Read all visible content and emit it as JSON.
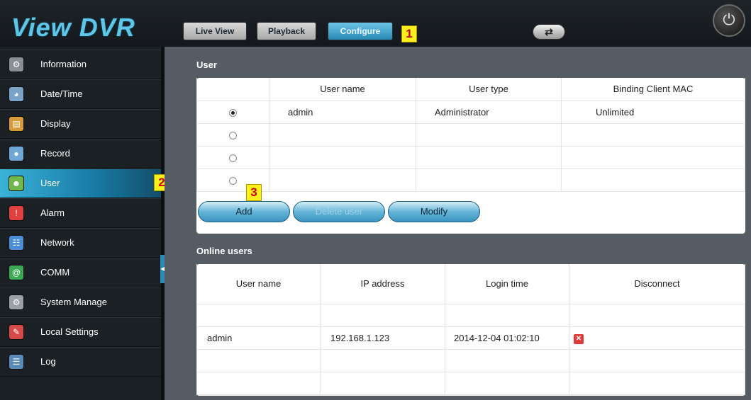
{
  "app": {
    "title": "View DVR"
  },
  "top_nav": {
    "live_view": "Live View",
    "playback": "Playback",
    "configure": "Configure"
  },
  "callouts": {
    "c1": "1",
    "c2": "2",
    "c3": "3"
  },
  "sidebar": {
    "items": [
      {
        "label": "Information",
        "icon": "information-icon",
        "color": "#8a8f96"
      },
      {
        "label": "Date/Time",
        "icon": "clock-icon",
        "color": "#7aa3c8"
      },
      {
        "label": "Display",
        "icon": "display-icon",
        "color": "#d99b3a"
      },
      {
        "label": "Record",
        "icon": "record-icon",
        "color": "#6fa7d6"
      },
      {
        "label": "User",
        "icon": "user-icon",
        "color": "#6fb84a"
      },
      {
        "label": "Alarm",
        "icon": "alarm-icon",
        "color": "#e04040"
      },
      {
        "label": "Network",
        "icon": "network-icon",
        "color": "#4a8ed8"
      },
      {
        "label": "COMM",
        "icon": "comm-icon",
        "color": "#3aa855"
      },
      {
        "label": "System Manage",
        "icon": "system-manage-icon",
        "color": "#9aa0a6"
      },
      {
        "label": "Local Settings",
        "icon": "local-settings-icon",
        "color": "#d84a4a"
      },
      {
        "label": "Log",
        "icon": "log-icon",
        "color": "#5a8ab8"
      }
    ],
    "active_index": 4
  },
  "user_section": {
    "title": "User",
    "columns": [
      "User name",
      "User type",
      "Binding Client MAC"
    ],
    "rows": [
      {
        "selected": true,
        "name": "admin",
        "type": "Administrator",
        "mac": "Unlimited"
      },
      {
        "selected": false,
        "name": "",
        "type": "",
        "mac": ""
      },
      {
        "selected": false,
        "name": "",
        "type": "",
        "mac": ""
      },
      {
        "selected": false,
        "name": "",
        "type": "",
        "mac": ""
      }
    ],
    "buttons": {
      "add": "Add",
      "delete": "Delete user",
      "modify": "Modify"
    }
  },
  "online_section": {
    "title": "Online users",
    "columns": [
      "User name",
      "IP address",
      "Login time",
      "Disconnect"
    ],
    "rows": [
      {
        "name": "",
        "ip": "",
        "time": "",
        "disconnect": false
      },
      {
        "name": "admin",
        "ip": "192.168.1.123",
        "time": "2014-12-04 01:02:10",
        "disconnect": true
      },
      {
        "name": "",
        "ip": "",
        "time": "",
        "disconnect": false
      },
      {
        "name": "",
        "ip": "",
        "time": "",
        "disconnect": false
      }
    ]
  },
  "colors": {
    "accent": "#2a8ab5",
    "callout": "#ffef1c",
    "callout_text": "#c8000a"
  }
}
